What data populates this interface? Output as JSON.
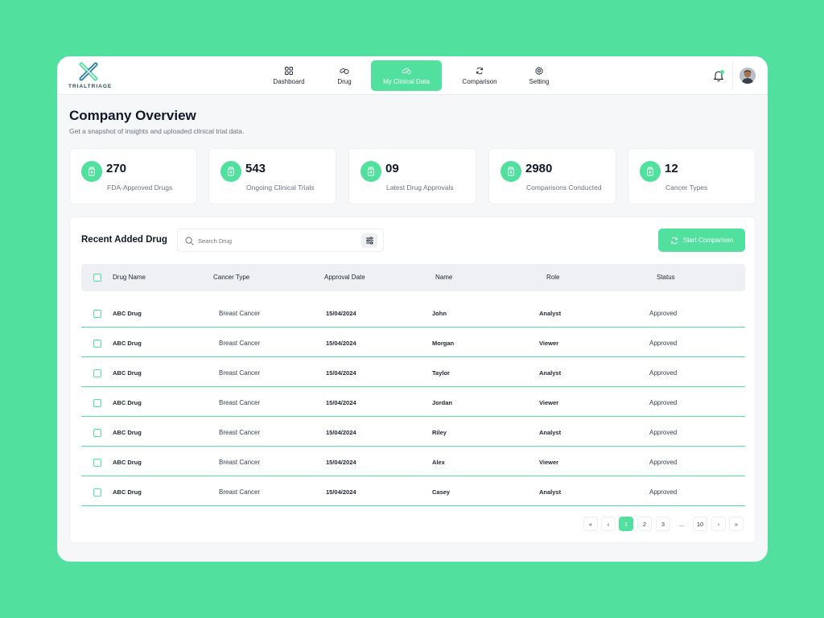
{
  "brand": {
    "name": "TRIALTRIAGE",
    "accent": "#52e09f"
  },
  "nav": {
    "items": [
      {
        "label": "Dashboard",
        "icon": "grid-icon",
        "active": false
      },
      {
        "label": "Drug",
        "icon": "pills-icon",
        "active": false
      },
      {
        "label": "My Clinical Data",
        "icon": "capsule-icon",
        "active": true
      },
      {
        "label": "Comparison",
        "icon": "refresh-icon",
        "active": false
      },
      {
        "label": "Setting",
        "icon": "gear-icon",
        "active": false
      }
    ]
  },
  "header": {
    "title": "Company Overview",
    "subtitle": "Get a snapshot of insights and uploaded clinical trial data."
  },
  "stats": [
    {
      "value": "270",
      "label": "FDA-Approved Drugs"
    },
    {
      "value": "543",
      "label": "Ongoing Clinical Trials"
    },
    {
      "value": "09",
      "label": "Latest Drug Approvals"
    },
    {
      "value": "2980",
      "label": "Comparisons Conducted"
    },
    {
      "value": "12",
      "label": "Cancer Types"
    }
  ],
  "table_panel": {
    "title": "Recent Added Drug",
    "search_placeholder": "Search Drug",
    "compare_label": "Start Comparison",
    "columns": [
      "Drug Name",
      "Cancer Type",
      "Approval Date",
      "Name",
      "Role",
      "Status"
    ],
    "rows": [
      [
        "ABC Drug",
        "Breast Cancer",
        "15/04/2024",
        "John",
        "Analyst",
        "Approved"
      ],
      [
        "ABC Drug",
        "Breast Cancer",
        "15/04/2024",
        "Morgan",
        "Viewer",
        "Approved"
      ],
      [
        "ABC Drug",
        "Breast Cancer",
        "15/04/2024",
        "Taylor",
        "Analyst",
        "Approved"
      ],
      [
        "ABC Drug",
        "Breast Cancer",
        "15/04/2024",
        "Jordan",
        "Viewer",
        "Approved"
      ],
      [
        "ABC Drug",
        "Breast Cancer",
        "15/04/2024",
        "Riley",
        "Analyst",
        "Approved"
      ],
      [
        "ABC Drug",
        "Breast Cancer",
        "15/04/2024",
        "Alex",
        "Viewer",
        "Approved"
      ],
      [
        "ABC Drug",
        "Breast Cancer",
        "15/04/2024",
        "Casey",
        "Analyst",
        "Approved"
      ]
    ]
  },
  "pagination": {
    "first": "«",
    "prev": "‹",
    "pages": [
      "1",
      "2",
      "3",
      "...",
      "10"
    ],
    "current": "1",
    "next": "›",
    "last": "»"
  }
}
